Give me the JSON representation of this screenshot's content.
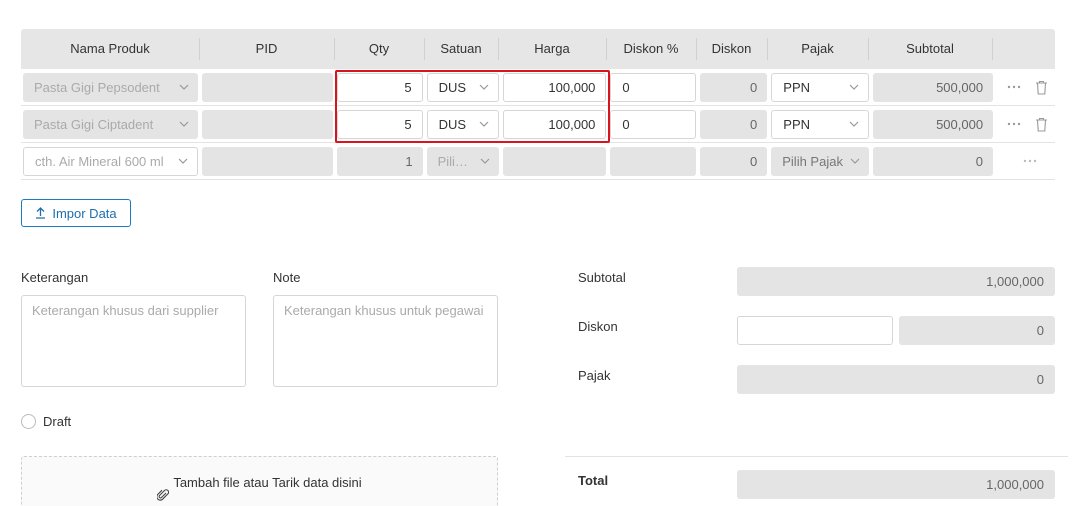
{
  "table": {
    "headers": [
      "Nama Produk",
      "PID",
      "Qty",
      "Satuan",
      "Harga",
      "Diskon %",
      "Diskon",
      "Pajak",
      "Subtotal"
    ],
    "rows": [
      {
        "product": "Pasta Gigi Pepsodent",
        "pid": "",
        "qty": "5",
        "unit": "DUS",
        "price": "100,000",
        "discount_pct": "0",
        "discount": "0",
        "tax": "PPN",
        "subtotal": "500,000"
      },
      {
        "product": "Pasta Gigi Ciptadent",
        "pid": "",
        "qty": "5",
        "unit": "DUS",
        "price": "100,000",
        "discount_pct": "0",
        "discount": "0",
        "tax": "PPN",
        "subtotal": "500,000"
      }
    ],
    "new_row": {
      "product_placeholder": "cth. Air Mineral 600 ml",
      "qty": "1",
      "unit_placeholder": "Pili…",
      "discount": "0",
      "tax_placeholder": "Pilih Pajak",
      "subtotal": "0"
    }
  },
  "import_button": "Impor Data",
  "notes": {
    "keterangan_label": "Keterangan",
    "keterangan_placeholder": "Keterangan khusus dari supplier",
    "note_label": "Note",
    "note_placeholder": "Keterangan khusus untuk pegawai"
  },
  "draft_label": "Draft",
  "dropzone_text": "Tambah file atau Tarik data disini",
  "summary": {
    "subtotal_label": "Subtotal",
    "subtotal_value": "1,000,000",
    "diskon_label": "Diskon",
    "diskon_value": "0",
    "pajak_label": "Pajak",
    "pajak_value": "0",
    "total_label": "Total",
    "total_value": "1,000,000"
  },
  "colors": {
    "accent": "#1e7bbf",
    "highlight": "#d9141c",
    "disabled": "#e4e4e4"
  }
}
